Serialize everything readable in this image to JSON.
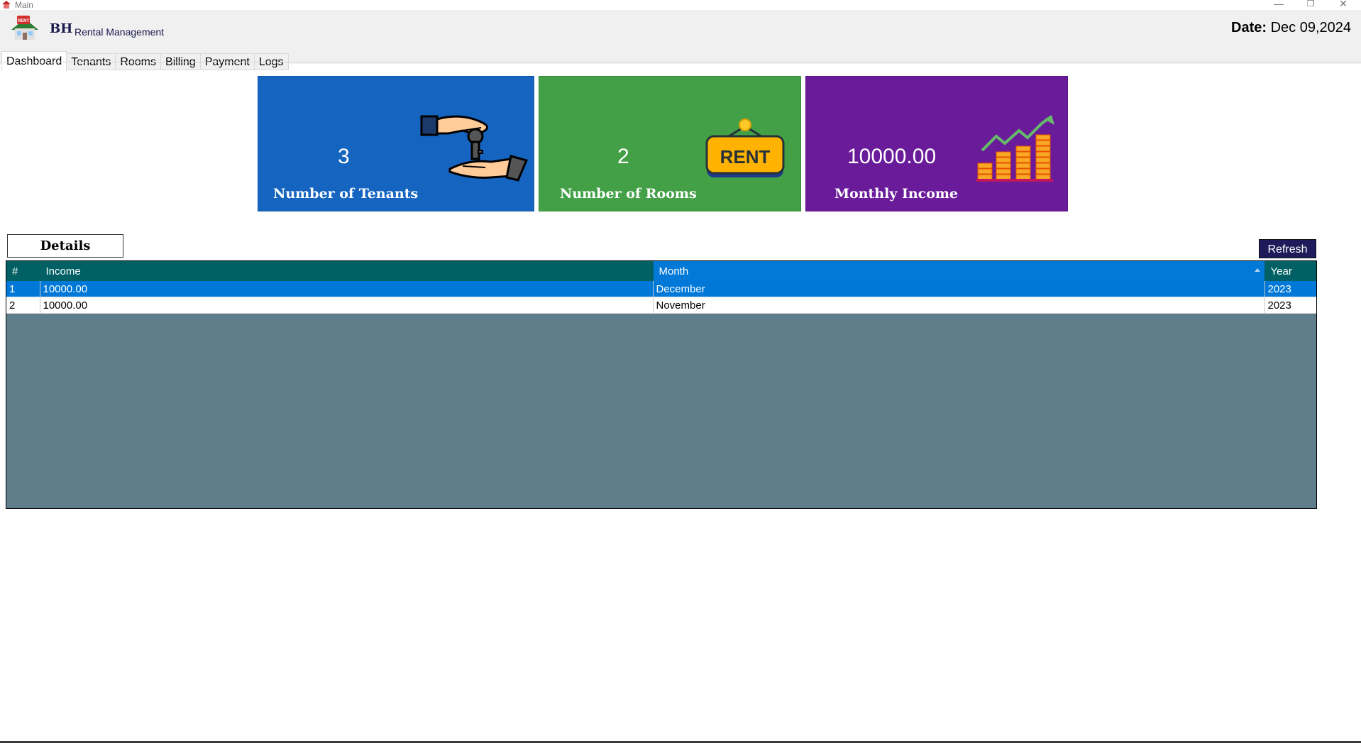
{
  "window": {
    "title": "Main"
  },
  "header": {
    "brand": "BH",
    "subtitle": "Rental Management",
    "date_label": "Date:",
    "date_value": "Dec 09,2024"
  },
  "tabs": [
    "Dashboard",
    "Tenants",
    "Rooms",
    "Billing",
    "Payment",
    "Logs"
  ],
  "active_tab": "Dashboard",
  "cards": {
    "tenants": {
      "value": "3",
      "label": "Number of Tenants",
      "color": "#1565c0"
    },
    "rooms": {
      "value": "2",
      "label": "Number of Rooms",
      "color": "#43a047",
      "sign_text": "RENT"
    },
    "income": {
      "value": "10000.00",
      "label": "Monthly Income",
      "color": "#6a1b9a"
    }
  },
  "details": {
    "label": "Details",
    "refresh_label": "Refresh",
    "columns": {
      "num": "#",
      "income": "Income",
      "month": "Month",
      "year": "Year"
    },
    "rows": [
      {
        "num": "1",
        "income": "10000.00",
        "month": "December",
        "year": "2023"
      },
      {
        "num": "2",
        "income": "10000.00",
        "month": "November",
        "year": "2023"
      }
    ]
  },
  "colors": {
    "header_bg": "#f0f0f0",
    "grid_header": "#006064",
    "grid_sorted_header": "#0278d7",
    "selection": "#0078d7",
    "grid_background": "#607d8b",
    "refresh_button": "#1d1b5a"
  },
  "icons": [
    "rent-house-icon",
    "key-handover-icon",
    "rent-sign-icon",
    "income-growth-icon",
    "minimize-icon",
    "restore-icon",
    "close-icon"
  ]
}
